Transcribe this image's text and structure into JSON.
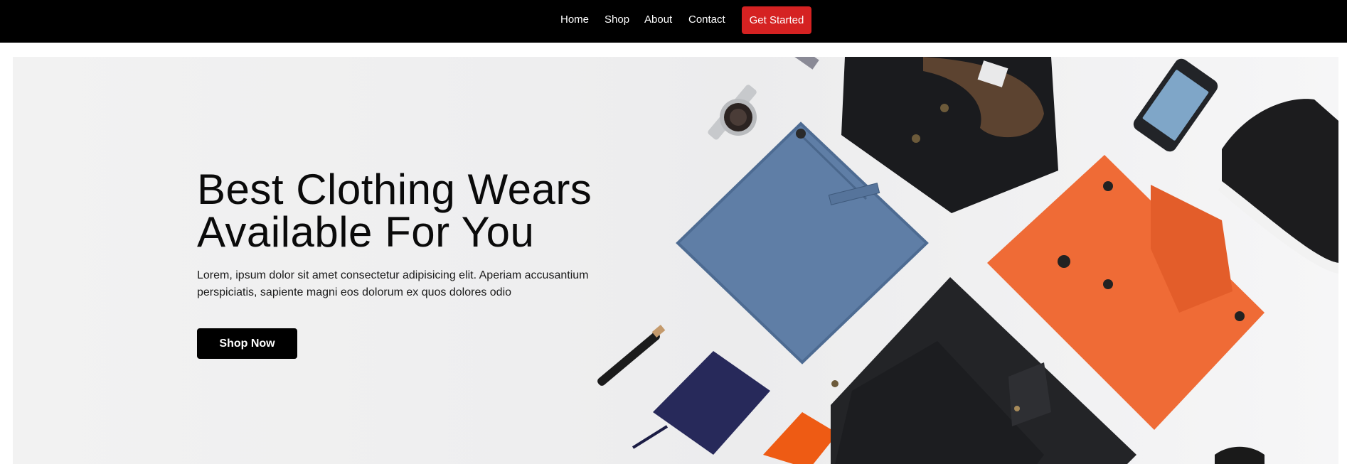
{
  "nav": {
    "links": [
      "Home",
      "Shop",
      "About",
      "Contact"
    ],
    "cta_label": "Get Started"
  },
  "hero": {
    "title_line1": "Best Clothing Wears",
    "title_line2": "Available For You",
    "text": "Lorem, ipsum dolor sit amet consectetur adipisicing elit. Aperiam accusantium perspiciatis, sapiente magni eos dolorum ex quos dolores odio",
    "button_label": "Shop Now"
  },
  "colors": {
    "nav_bg": "#000000",
    "cta_bg": "#d52222",
    "hero_bg": "#efeff0",
    "button_bg": "#000000"
  }
}
